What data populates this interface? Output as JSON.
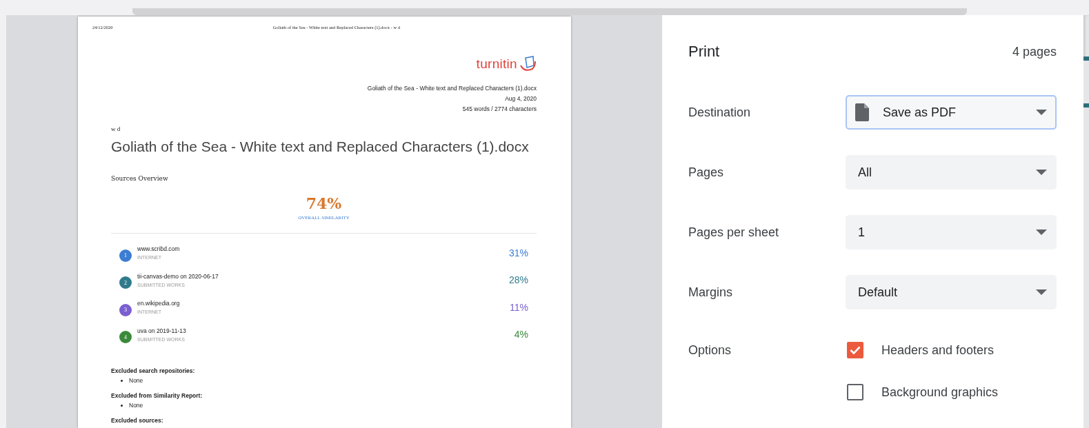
{
  "preview_page": {
    "header_date": "24/12/2020",
    "header_title": "Goliath of the Sea - White text and Replaced Characters (1).docx - w d",
    "logo": "turnitin",
    "meta": [
      "Goliath of the Sea - White text and Replaced Characters (1).docx",
      "Aug 4, 2020",
      "545 words / 2774 characters"
    ],
    "author": "w d",
    "title": "Goliath of the Sea - White text and Replaced Characters (1).docx",
    "section_title": "Sources Overview",
    "overall": {
      "value": "74%",
      "label": "OVERALL SIMILARITY"
    },
    "sources": [
      {
        "index": "1",
        "name": "www.scribd.com",
        "type": "INTERNET",
        "percent": "31%",
        "color": "#3b7dd3"
      },
      {
        "index": "2",
        "name": "tii-canvas-demo on 2020-06-17",
        "type": "SUBMITTED WORKS",
        "percent": "28%",
        "color": "#2f7b8c"
      },
      {
        "index": "3",
        "name": "en.wikipedia.org",
        "type": "INTERNET",
        "percent": "11%",
        "color": "#7b5fd1"
      },
      {
        "index": "4",
        "name": "uva on 2019-11-13",
        "type": "SUBMITTED WORKS",
        "percent": "4%",
        "color": "#3b8a3a"
      }
    ],
    "exclusions": [
      {
        "heading": "Excluded search repositories:",
        "items": [
          "None"
        ]
      },
      {
        "heading": "Excluded from Similarity Report:",
        "items": [
          "None"
        ]
      },
      {
        "heading": "Excluded sources:"
      }
    ]
  },
  "print_panel": {
    "title": "Print",
    "page_count": "4 pages",
    "settings": [
      {
        "label": "Destination",
        "value": "Save as PDF",
        "kind": "destination",
        "focused": true
      },
      {
        "label": "Pages",
        "value": "All",
        "kind": "dropdown",
        "focused": false
      },
      {
        "label": "Pages per sheet",
        "value": "1",
        "kind": "dropdown",
        "focused": false
      },
      {
        "label": "Margins",
        "value": "Default",
        "kind": "dropdown",
        "focused": false
      }
    ],
    "options_label": "Options",
    "options": [
      {
        "label": "Headers and footers",
        "checked": true
      },
      {
        "label": "Background graphics",
        "checked": false
      }
    ]
  }
}
